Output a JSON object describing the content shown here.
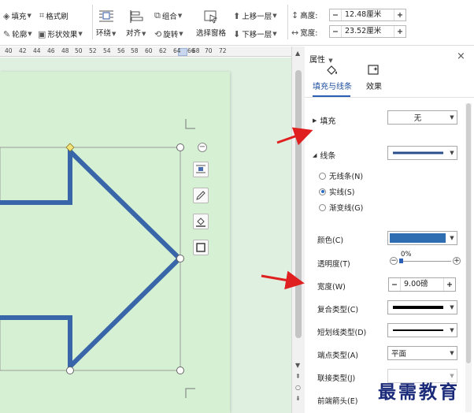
{
  "ribbon": {
    "fill_label": "填充",
    "format_painter_label": "格式刷",
    "outline_label": "轮廓",
    "shape_effects_label": "形状效果",
    "wrap_label": "环绕",
    "align_label": "对齐",
    "group_label": "组合",
    "rotate_label": "旋转",
    "selection_pane_label": "选择窗格",
    "bring_forward_label": "上移一层",
    "send_backward_label": "下移一层",
    "height_label": "高度:",
    "height_value": "12.48厘米",
    "width_label": "宽度:",
    "width_value": "23.52厘米"
  },
  "ruler": {
    "ticks": [
      "40",
      "42",
      "44",
      "46",
      "48",
      "50",
      "52",
      "54",
      "56",
      "58",
      "60",
      "62",
      "64",
      "66",
      "68",
      "70",
      "72"
    ]
  },
  "panel": {
    "title": "属性",
    "tabs": [
      {
        "label": "填充与线条",
        "active": true
      },
      {
        "label": "效果",
        "active": false
      }
    ],
    "fill_section": "填充",
    "fill_value": "无",
    "line_section": "线条",
    "line_options": [
      "无线条(N)",
      "实线(S)",
      "渐变线(G)"
    ],
    "line_selected": "实线(S)",
    "color_label": "颜色(C)",
    "line_color": "#2f6db3",
    "transparency_label": "透明度(T)",
    "transparency_value": "0%",
    "width_label": "宽度(W)",
    "width_value": "9.00磅",
    "compound_label": "复合类型(C)",
    "dash_label": "短划线类型(D)",
    "cap_label": "端点类型(A)",
    "cap_value": "平面",
    "join_label": "联接类型(J)",
    "arrow_label": "前端箭头(E)"
  },
  "colors": {
    "accent": "#2b5fb6",
    "shape_stroke": "#3866a8",
    "page_bg": "#d6f0d4",
    "annotation_red": "#e02020"
  },
  "watermark": "最需教育"
}
